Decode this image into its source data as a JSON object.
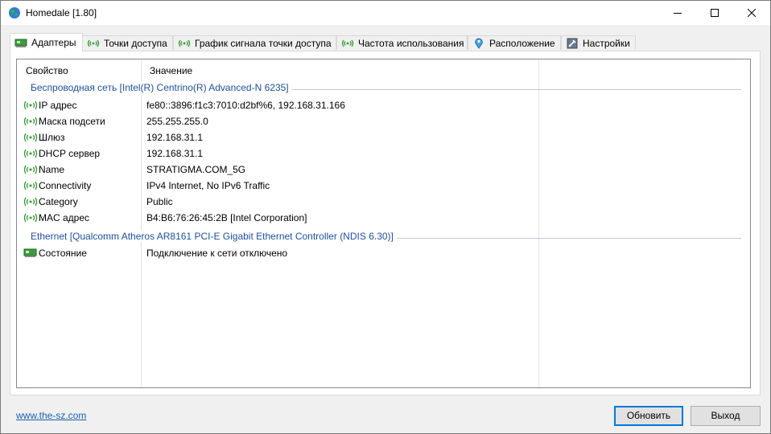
{
  "window": {
    "title": "Homedale [1.80]"
  },
  "tabs": [
    {
      "label": "Адаптеры",
      "icon": "network-card-icon"
    },
    {
      "label": "Точки доступа",
      "icon": "signal-icon"
    },
    {
      "label": "График сигнала точки доступа",
      "icon": "signal-icon"
    },
    {
      "label": "Частота использования",
      "icon": "signal-icon"
    },
    {
      "label": "Расположение",
      "icon": "location-pin-icon"
    },
    {
      "label": "Настройки",
      "icon": "settings-icon"
    }
  ],
  "list": {
    "columns": [
      "Свойство",
      "Значение"
    ],
    "groups": [
      {
        "title": "Беспроводная сеть [Intel(R) Centrino(R) Advanced-N 6235]",
        "rows": [
          {
            "icon": "signal-icon",
            "property": "IP адрес",
            "value": "fe80::3896:f1c3:7010:d2bf%6, 192.168.31.166"
          },
          {
            "icon": "signal-icon",
            "property": "Маска подсети",
            "value": "255.255.255.0"
          },
          {
            "icon": "signal-icon",
            "property": "Шлюз",
            "value": "192.168.31.1"
          },
          {
            "icon": "signal-icon",
            "property": "DHCP сервер",
            "value": "192.168.31.1"
          },
          {
            "icon": "signal-icon",
            "property": "Name",
            "value": "STRATIGMA.COM_5G"
          },
          {
            "icon": "signal-icon",
            "property": "Connectivity",
            "value": "IPv4 Internet, No IPv6 Traffic"
          },
          {
            "icon": "signal-icon",
            "property": "Category",
            "value": "Public"
          },
          {
            "icon": "signal-icon",
            "property": "MAC адрес",
            "value": "B4:B6:76:26:45:2B [Intel Corporation]"
          }
        ]
      },
      {
        "title": "Ethernet [Qualcomm Atheros AR8161 PCI-E Gigabit Ethernet Controller (NDIS 6.30)]",
        "rows": [
          {
            "icon": "network-card-icon",
            "property": "Состояние",
            "value": "Подключение к сети отключено"
          }
        ]
      }
    ]
  },
  "footer": {
    "link": "www.the-sz.com",
    "refresh_label": "Обновить",
    "exit_label": "Выход"
  },
  "colors": {
    "group_title": "#1e50a2",
    "link": "#1a5fb4",
    "signal_green": "#2e9a2e"
  }
}
